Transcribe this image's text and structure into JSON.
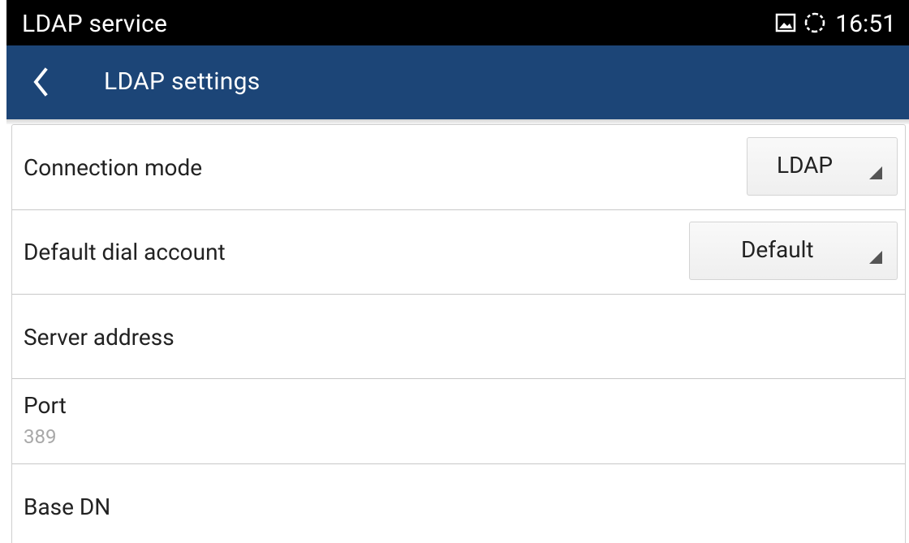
{
  "status_bar": {
    "app_name": "LDAP service",
    "time": "16:51",
    "icons": [
      "image-icon",
      "sync-icon"
    ]
  },
  "action_bar": {
    "title": "LDAP settings",
    "back_icon": "chevron-left-icon"
  },
  "settings": {
    "connection_mode": {
      "label": "Connection mode",
      "value": "LDAP"
    },
    "default_dial_account": {
      "label": "Default dial account",
      "value": "Default"
    },
    "server_address": {
      "label": "Server address"
    },
    "port": {
      "label": "Port",
      "value": "389"
    },
    "base_dn": {
      "label": "Base DN"
    }
  },
  "colors": {
    "status_bar_bg": "#000000",
    "action_bar_bg": "#1c4577",
    "text_primary": "#222222",
    "text_secondary": "#a8a8a8",
    "divider": "#c8c8c8"
  }
}
